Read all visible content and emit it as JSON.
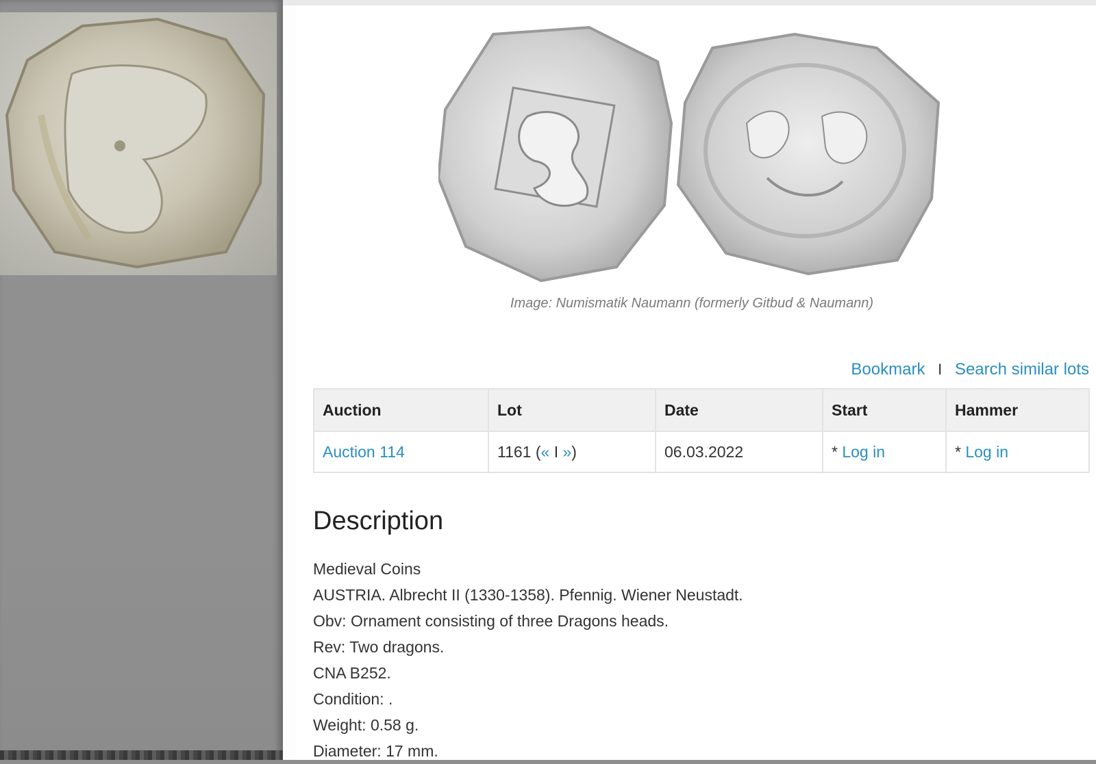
{
  "image_caption": "Image: Numismatik Naumann (formerly Gitbud & Naumann)",
  "actions": {
    "bookmark": "Bookmark",
    "separator": "I",
    "search_similar": "Search similar lots"
  },
  "table": {
    "headers": [
      "Auction",
      "Lot",
      "Date",
      "Start",
      "Hammer"
    ],
    "row": {
      "auction": "Auction 114",
      "lot_number": "1161",
      "lot_open": " (",
      "lot_prev": "«",
      "lot_sep": " I ",
      "lot_next": "»",
      "lot_close": ")",
      "date": "06.03.2022",
      "start_prefix": "* ",
      "start_link": "Log in",
      "hammer_prefix": "* ",
      "hammer_link": "Log in"
    }
  },
  "description": {
    "title": "Description",
    "lines": [
      "Medieval Coins",
      "AUSTRIA. Albrecht II (1330-1358). Pfennig. Wiener Neustadt.",
      "Obv: Ornament consisting of three Dragons heads.",
      "Rev: Two dragons.",
      "CNA B252.",
      "Condition: .",
      "Weight: 0.58 g.",
      "Diameter: 17 mm."
    ]
  },
  "colors": {
    "link": "#2a8fc1",
    "left_panel": "#8f8f8f",
    "header_bg": "#f0f0f0"
  }
}
